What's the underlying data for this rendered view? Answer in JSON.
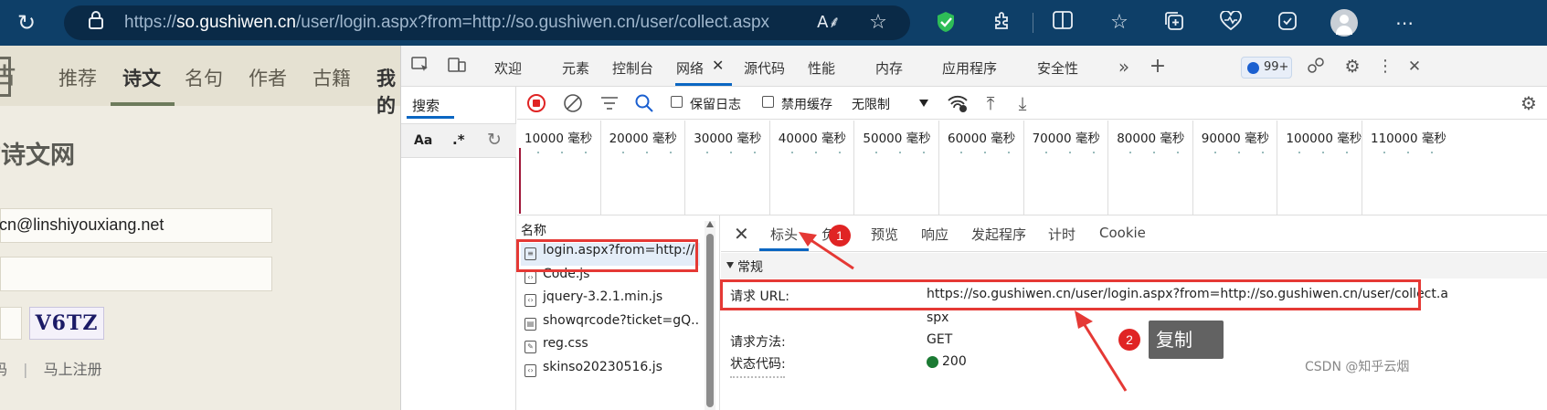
{
  "browser": {
    "url_scheme": "https://",
    "url_host": "so.gushiwen.cn",
    "url_rest": "/user/login.aspx?from=http://so.gushiwen.cn/user/collect.aspx"
  },
  "site": {
    "nav": [
      "推荐",
      "诗文",
      "名句",
      "作者",
      "古籍",
      "我的"
    ],
    "active_nav": "诗文",
    "title_fragment": "古诗文网",
    "email_value": "tcn@linshiyouxiang.net",
    "captcha_text": "V6TZ",
    "footer_fragment": "码",
    "footer_link": "马上注册",
    "colors": {
      "nav_bg": "#e5e1d2",
      "page_bg": "#efece2",
      "accent": "#6d7b5c"
    }
  },
  "devtools": {
    "tabs": [
      "欢迎",
      "元素",
      "控制台",
      "网络",
      "源代码",
      "性能",
      "内存",
      "应用程序",
      "安全性"
    ],
    "active_tab": "网络",
    "issues_badge": "99+",
    "search_tab": "搜索",
    "search_options": {
      "match_case": "Aa",
      "regex": ".*"
    },
    "toolbar": {
      "preserve_log": "保留日志",
      "disable_cache": "禁用缓存",
      "throttling": "无限制"
    },
    "timeline_ticks": [
      "10000 毫秒",
      "20000 毫秒",
      "30000 毫秒",
      "40000 毫秒",
      "50000 毫秒",
      "60000 毫秒",
      "70000 毫秒",
      "80000 毫秒",
      "90000 毫秒",
      "100000 毫秒",
      "110000 毫秒"
    ],
    "request_list": {
      "header": "名称",
      "rows": [
        {
          "name": "login.aspx?from=http://...",
          "icon": "document-icon"
        },
        {
          "name": "Code.js",
          "icon": "script-icon"
        },
        {
          "name": "jquery-3.2.1.min.js",
          "icon": "script-icon"
        },
        {
          "name": "showqrcode?ticket=gQ...",
          "icon": "file-icon"
        },
        {
          "name": "reg.css",
          "icon": "stylesheet-icon"
        },
        {
          "name": "skinso20230516.js",
          "icon": "script-icon"
        }
      ]
    },
    "details": {
      "tabs": [
        "标头",
        "负载",
        "预览",
        "响应",
        "发起程序",
        "计时",
        "Cookie"
      ],
      "active_tab": "标头",
      "section": "常规",
      "request_url_label": "请求 URL:",
      "request_url_value": "https://so.gushiwen.cn/user/login.aspx?from=http://so.gushiwen.cn/user/collect.a",
      "request_url_wrap": "spx",
      "method_label": "请求方法:",
      "method_value": "GET",
      "status_label": "状态代码:",
      "status_value": "200",
      "status_color": "#1b7a33"
    }
  },
  "annotations": {
    "marker_1": "1",
    "marker_2": "2",
    "copy_label": "复制",
    "color": "#e53935"
  },
  "watermark": "CSDN @知乎云烟"
}
